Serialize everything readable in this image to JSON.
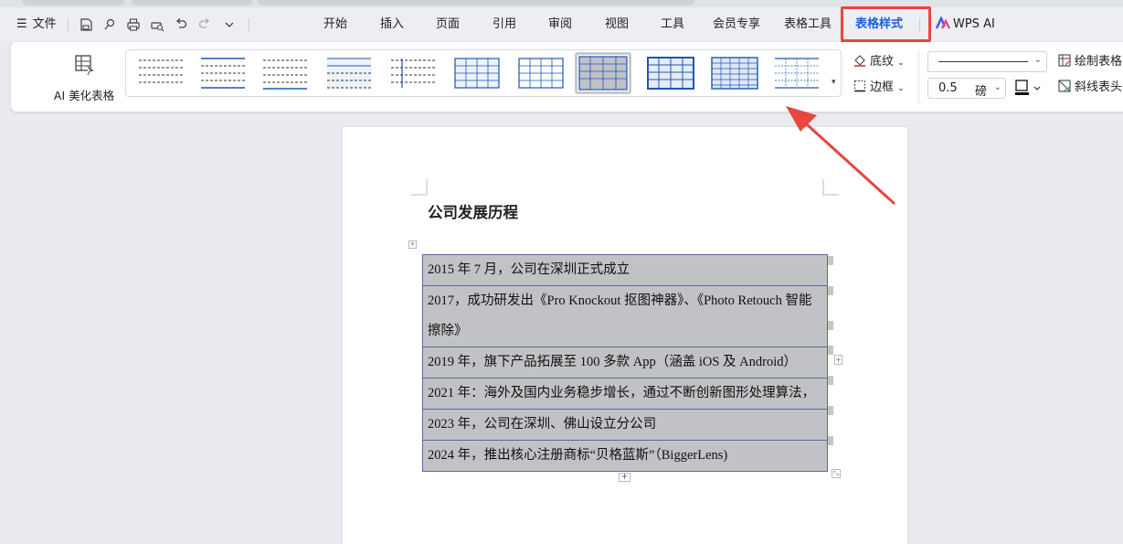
{
  "colors": {
    "accent": "#1c5fd6",
    "highlight": "#e8463f",
    "table_fill": "#c1c2c5",
    "table_border": "#5a6c96"
  },
  "menubar": {
    "file_label": "文件",
    "tabs": [
      {
        "label": "开始"
      },
      {
        "label": "插入"
      },
      {
        "label": "页面"
      },
      {
        "label": "引用"
      },
      {
        "label": "审阅"
      },
      {
        "label": "视图"
      },
      {
        "label": "工具"
      },
      {
        "label": "会员专享"
      },
      {
        "label": "表格工具"
      },
      {
        "label": "表格样式",
        "active": true
      }
    ],
    "wps_ai_label": "WPS AI"
  },
  "ribbon": {
    "ai_beautify_label": "AI 美化表格",
    "shading_label": "底纹",
    "border_label": "边框",
    "line_width_value": "0.5",
    "line_width_unit": "磅",
    "draw_table_label": "绘制表格",
    "diagonal_header_label": "斜线表头"
  },
  "document": {
    "title": "公司发展历程",
    "rows": [
      "2015 年 7 月，公司在深圳正式成立",
      "2017，成功研发出《Pro Knockout 抠图神器》、《Photo Retouch 智能擦除》",
      "2019 年，旗下产品拓展至 100 多款 App（涵盖 iOS 及 Android）",
      "2021 年：海外及国内业务稳步增长，通过不断创新图形处理算法，",
      "2023 年，公司在深圳、佛山设立分公司",
      "2024 年，推出核心注册商标“贝格蓝斯”（BiggerLens)"
    ]
  }
}
